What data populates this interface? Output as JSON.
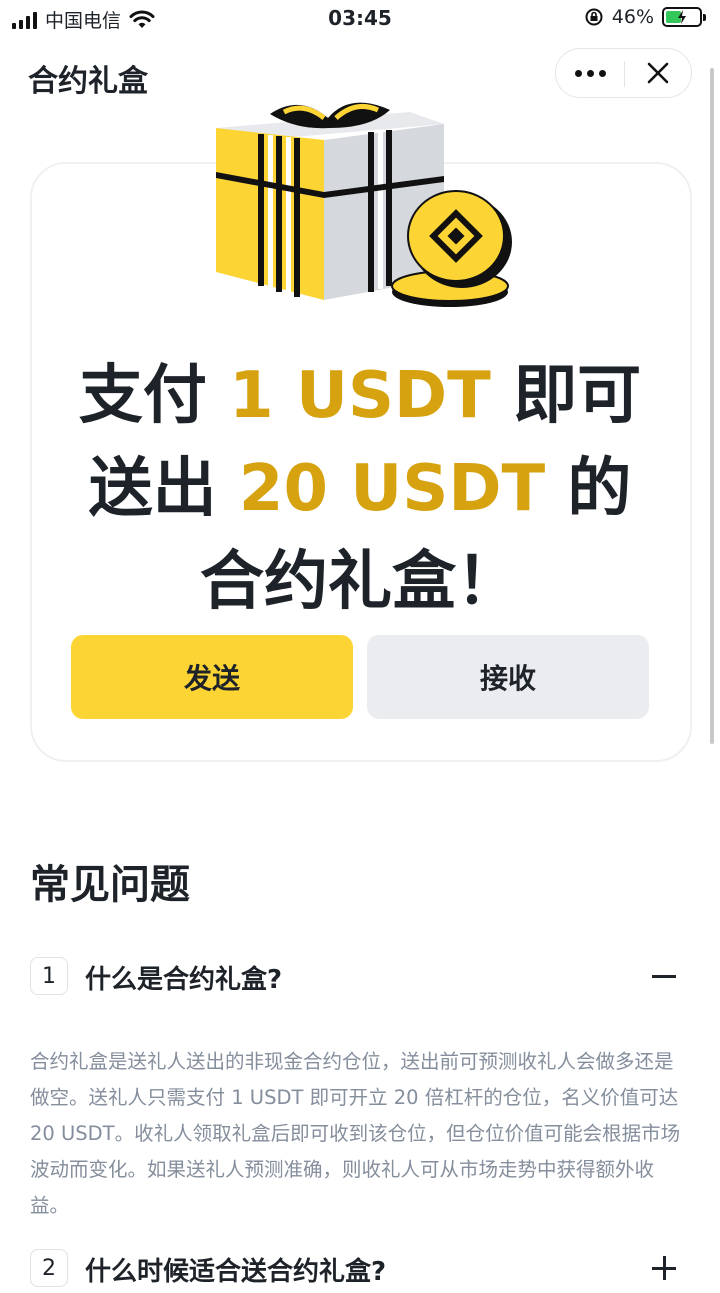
{
  "status_bar": {
    "carrier": "中国电信",
    "time": "03:45",
    "battery": "46%",
    "battery_level": 0.46
  },
  "header": {
    "title": "合约礼盒"
  },
  "hero": {
    "line1_a": "支付 ",
    "line1_b": "1 USDT",
    "line1_c": " 即可",
    "line2_a": "送出 ",
    "line2_b": "20 USDT",
    "line2_c": " 的",
    "line3": "合约礼盒！",
    "send_label": "发送",
    "receive_label": "接收"
  },
  "faq": {
    "title": "常见问题",
    "items": [
      {
        "num": "1",
        "question": "什么是合约礼盒?",
        "expanded": true,
        "answer": "合约礼盒是送礼人送出的非现金合约仓位，送出前可预测收礼人会做多还是做空。送礼人只需支付 1 USDT 即可开立 20 倍杠杆的仓位，名义价值可达 20 USDT。收礼人领取礼盒后即可收到该仓位，但仓位价值可能会根据市场波动而变化。如果送礼人预测准确，则收礼人可从市场走势中获得额外收益。"
      },
      {
        "num": "2",
        "question": "什么时候适合送合约礼盒?",
        "expanded": false
      }
    ]
  },
  "colors": {
    "accent_yellow": "#fcd535",
    "highlight_gold": "#d7a20f",
    "text_dark": "#1e2329",
    "text_muted": "#848e9c"
  }
}
